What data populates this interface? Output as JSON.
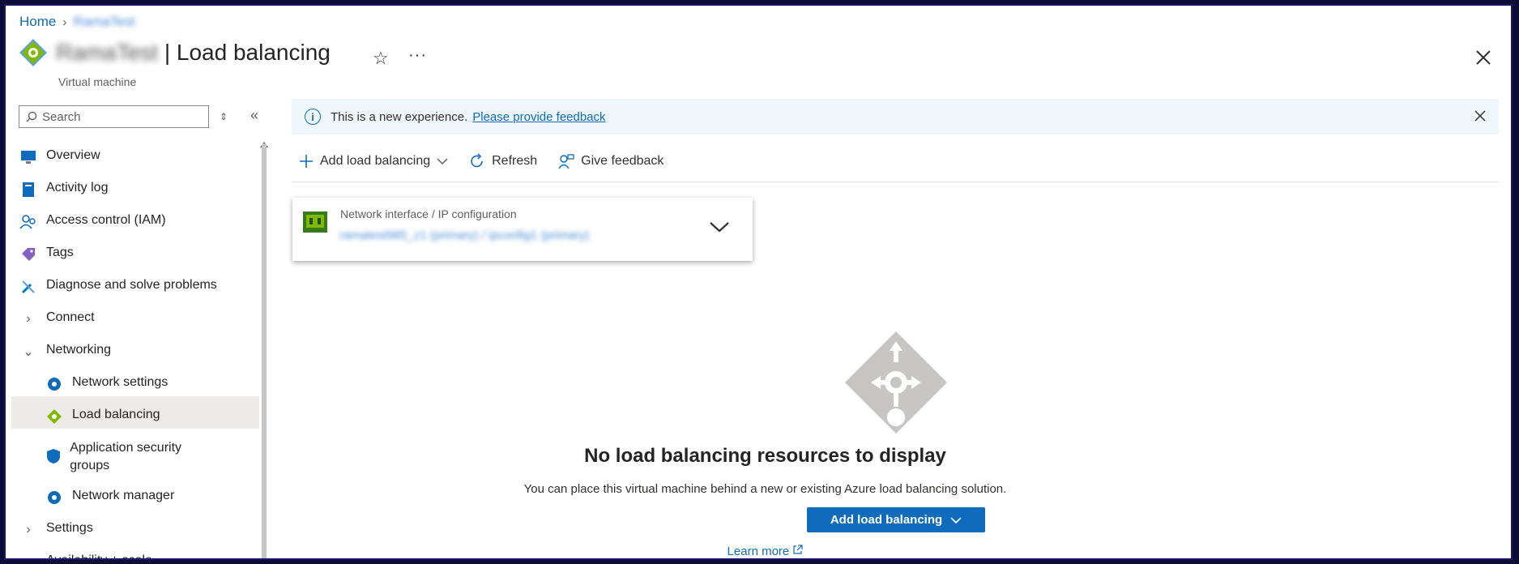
{
  "breadcrumb": {
    "home": "Home",
    "resource": "RamaTest"
  },
  "header": {
    "resource_name": "RamaTest",
    "separator": "|",
    "title": "Load balancing",
    "subtitle": "Virtual machine"
  },
  "sidebar": {
    "search_placeholder": "Search",
    "items": [
      {
        "label": "Overview"
      },
      {
        "label": "Activity log"
      },
      {
        "label": "Access control (IAM)"
      },
      {
        "label": "Tags"
      },
      {
        "label": "Diagnose and solve problems"
      },
      {
        "label": "Connect"
      },
      {
        "label": "Networking"
      },
      {
        "label": "Network settings"
      },
      {
        "label": "Load balancing"
      },
      {
        "label": "Application security groups"
      },
      {
        "label": "Network manager"
      },
      {
        "label": "Settings"
      },
      {
        "label": "Availability + scale"
      }
    ]
  },
  "banner": {
    "text": "This is a new experience.",
    "link": "Please provide feedback"
  },
  "toolbar": {
    "add": "Add load balancing",
    "refresh": "Refresh",
    "feedback": "Give feedback"
  },
  "card": {
    "label": "Network interface / IP configuration",
    "value": "ramatest985_z1 (primary) / ipconfig1 (primary)"
  },
  "empty_state": {
    "title": "No load balancing resources to display",
    "description": "You can place this virtual machine behind a new or existing Azure load balancing solution.",
    "button": "Add load balancing",
    "learn_more": "Learn more"
  },
  "colors": {
    "accent": "#0f6cbd",
    "banner_bg": "#eff6fc",
    "active_nav_bg": "#edebe9"
  }
}
